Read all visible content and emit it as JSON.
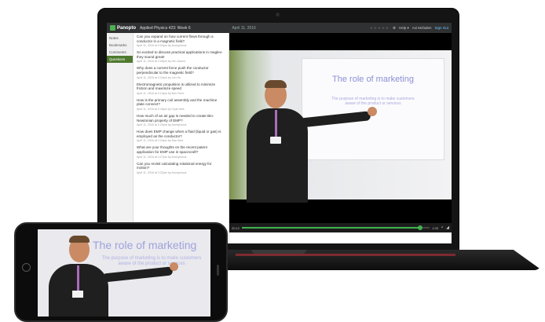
{
  "header": {
    "brand": "Panopto",
    "title": "Applied Physics 423: Week 6",
    "date": "April 11, 2016",
    "rating": "☆☆☆☆☆",
    "help": "Help ▾",
    "user": "Avi Mcfaden",
    "signout": "Sign Out"
  },
  "sidebar": {
    "items": [
      {
        "label": "Notes"
      },
      {
        "label": "Bookmarks"
      },
      {
        "label": "Comments"
      },
      {
        "label": "Questions",
        "active": true
      }
    ]
  },
  "questions": [
    {
      "text": "Can you expand on how current flows through a conductor in a magnetic field?",
      "meta": "April 11, 2016 at 2:03pm by Anonymous"
    },
    {
      "text": "So excited to discuss practical applications in maglev- they sound great!",
      "meta": "April 11, 2016 at 2:05pm by Jen Juarez"
    },
    {
      "text": "Why does a current force push the conductor perpendicular to the magnetic field?",
      "meta": "April 11, 2016 at 2:10pm by Jon Hu"
    },
    {
      "text": "Electromagnetic propulsion is utilized to minimize friction and maximize speed",
      "meta": "April 11, 2016 at 2:14pm by Ben Ferer"
    },
    {
      "text": "How is the primary coil assembly and the machine plate connect?",
      "meta": "April 11, 2016 at 2:16pm by Cyan Ikes"
    },
    {
      "text": "How much of an air gap is needed to create Bio-Newtonian property of EMP?",
      "meta": "April 11, 2016 at 2:20pm by Anonymous"
    },
    {
      "text": "How does EMP change when a fluid (liquid or gas) is employed as the conductor?",
      "meta": "April 11, 2016 at 2:24pm by Dan Bart"
    },
    {
      "text": "What are your thoughts on the recent patent application for EMP use in spacecraft?",
      "meta": "April 11, 2016 at 2:27pm by Anonymous"
    },
    {
      "text": "Can you revisit calculating rotational energy for motion?",
      "meta": "April 11, 2016 at 2:32pm by Anonymous"
    }
  ],
  "ask_placeholder": "Ask the presenter a question. Your question will be sent to everyone",
  "slide": {
    "title": "The role of marketing",
    "body": "The purpose of marketing is to make customers aware of the product or services"
  },
  "player": {
    "time_elapsed": "20:12",
    "time_total": "1:05",
    "progress": 0.95,
    "speed_icon": "speed-icon",
    "volume_icon": "volume-icon",
    "quality": "Quality"
  },
  "colors": {
    "accent": "#4caf50",
    "active_nav": "#4f7a2e",
    "progress": "#3fb34f"
  }
}
